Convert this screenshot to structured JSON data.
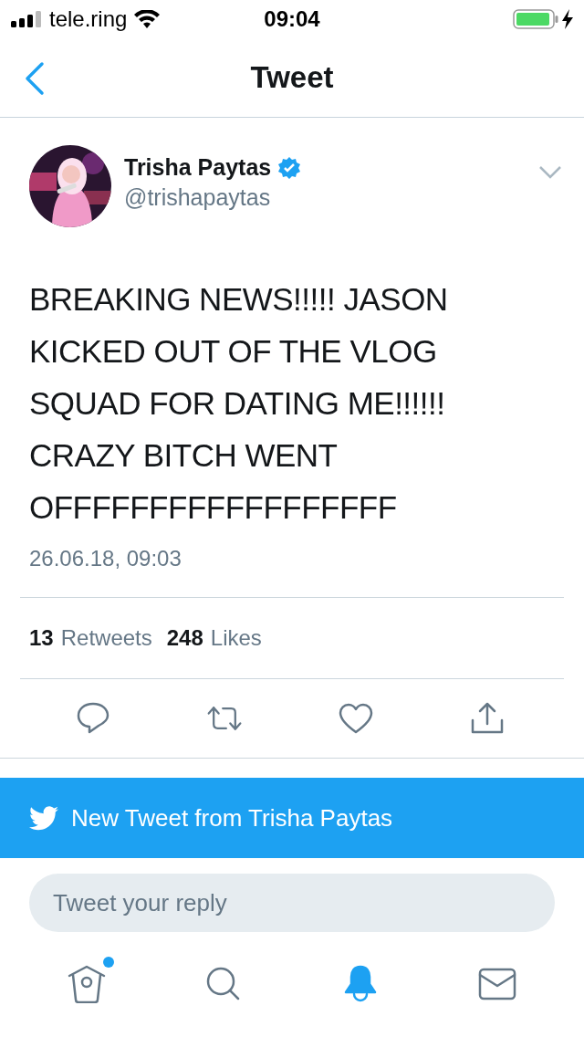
{
  "status_bar": {
    "carrier": "tele.ring",
    "time": "09:04",
    "charging": true
  },
  "nav": {
    "title": "Tweet"
  },
  "tweet": {
    "author": "Trisha Paytas",
    "verified": true,
    "handle": "@trishapaytas",
    "text": "BREAKING NEWS!!!!! JASON KICKED OUT OF THE VLOG SQUAD FOR DATING ME!!!!!! CRAZY BITCH WENT OFFFFFFFFFFFFFFFFFF",
    "timestamp": "26.06.18, 09:03",
    "stats": [
      {
        "count": "13",
        "label": "Retweets"
      },
      {
        "count": "248",
        "label": "Likes"
      }
    ],
    "actions": [
      {
        "kind": "reply"
      },
      {
        "kind": "retweet"
      },
      {
        "kind": "like"
      },
      {
        "kind": "share"
      }
    ]
  },
  "banner": {
    "text": "New Tweet from Trisha Paytas"
  },
  "reply": {
    "placeholder": "Tweet your reply"
  },
  "tab_bar": [
    {
      "kind": "home",
      "selected": false,
      "badge": true
    },
    {
      "kind": "search",
      "selected": false,
      "badge": false
    },
    {
      "kind": "notifications",
      "selected": true,
      "badge": false
    },
    {
      "kind": "messages",
      "selected": false,
      "badge": false
    }
  ]
}
